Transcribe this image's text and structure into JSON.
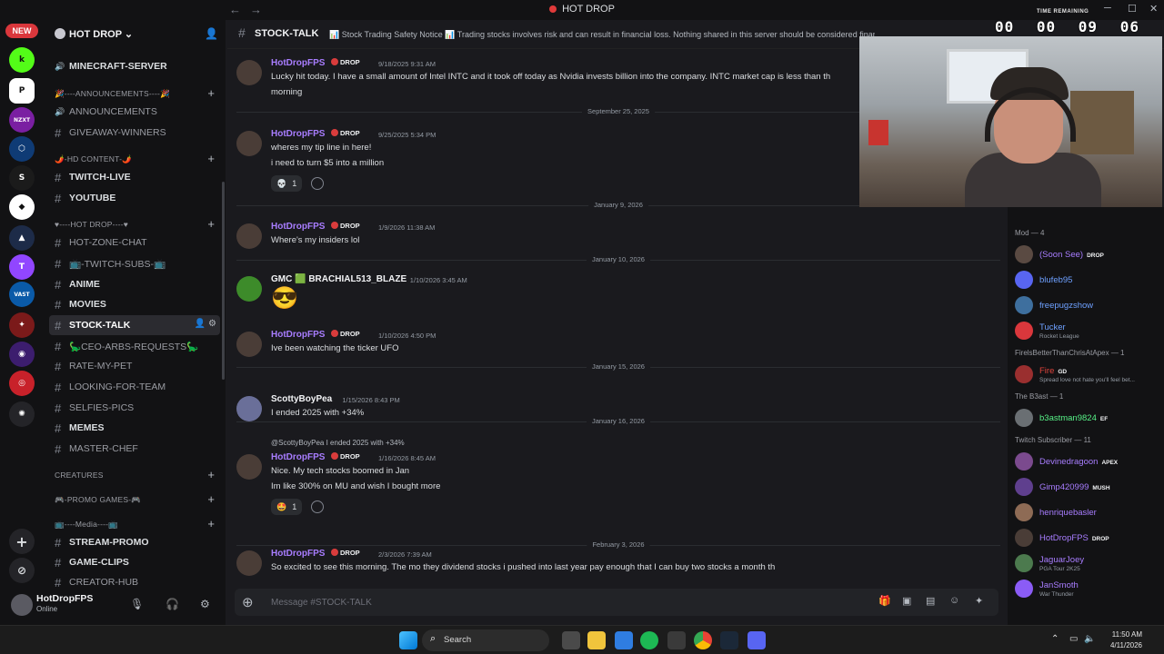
{
  "window": {
    "title": "HOT DROP"
  },
  "server_rail": {
    "new_badge": "NEW",
    "servers": [
      {
        "name": "kick-server",
        "color": "#53fc18",
        "glyph": "k"
      },
      {
        "name": "p-server",
        "color": "#ffffff",
        "glyph": "P"
      },
      {
        "name": "nzxt-server",
        "color": "#7a1fa2",
        "glyph": "NZXT"
      },
      {
        "name": "hex-server",
        "color": "#0f3b75",
        "glyph": "⬡"
      },
      {
        "name": "sanctuary-server",
        "color": "#1b1b1b",
        "glyph": "S"
      },
      {
        "name": "cube-server",
        "color": "#ffffff",
        "glyph": "◆"
      },
      {
        "name": "mountain-server",
        "color": "#1d2b48",
        "glyph": "▲"
      },
      {
        "name": "twitch-server",
        "color": "#9146ff",
        "glyph": "T"
      },
      {
        "name": "vast-server",
        "color": "#0a5aa8",
        "glyph": "VAST"
      },
      {
        "name": "feather-server",
        "color": "#7b1a1a",
        "glyph": "✦"
      },
      {
        "name": "purple-server",
        "color": "#3c1d6e",
        "glyph": "◉"
      },
      {
        "name": "red-ring-server",
        "color": "#c8212a",
        "glyph": "◎"
      },
      {
        "name": "dark-server",
        "color": "#242428",
        "glyph": "✺"
      }
    ]
  },
  "guild": {
    "name": "HOT DROP",
    "categories_and_channels": [
      {
        "kind": "channel",
        "label": "MINECRAFT-SERVER",
        "muted": false,
        "icon": "speaker"
      },
      {
        "kind": "category",
        "label": "🎉----ANNOUNCEMENTS----🎉"
      },
      {
        "kind": "channel",
        "label": "ANNOUNCEMENTS",
        "muted": true,
        "icon": "speaker"
      },
      {
        "kind": "channel",
        "label": "GIVEAWAY-WINNERS",
        "muted": true
      },
      {
        "kind": "category",
        "label": "🌶️-HD CONTENT-🌶️"
      },
      {
        "kind": "channel",
        "label": "TWITCH-LIVE",
        "muted": false
      },
      {
        "kind": "channel",
        "label": "YOUTUBE",
        "muted": false
      },
      {
        "kind": "category",
        "label": "♥----HOT DROP----♥"
      },
      {
        "kind": "channel",
        "label": "HOT-ZONE-CHAT",
        "muted": true
      },
      {
        "kind": "channel",
        "label": "📺-TWITCH-SUBS-📺",
        "muted": true
      },
      {
        "kind": "channel",
        "label": "ANIME",
        "muted": false
      },
      {
        "kind": "channel",
        "label": "MOVIES",
        "muted": false
      },
      {
        "kind": "channel",
        "label": "STOCK-TALK",
        "muted": false,
        "selected": true
      },
      {
        "kind": "channel",
        "label": "🦕CEO-ARBS-REQUESTS🦕",
        "muted": true
      },
      {
        "kind": "channel",
        "label": "RATE-MY-PET",
        "muted": true
      },
      {
        "kind": "channel",
        "label": "LOOKING-FOR-TEAM",
        "muted": true
      },
      {
        "kind": "channel",
        "label": "SELFIES-PICS",
        "muted": true
      },
      {
        "kind": "channel",
        "label": "MEMES",
        "muted": false
      },
      {
        "kind": "channel",
        "label": "MASTER-CHEF",
        "muted": true
      },
      {
        "kind": "category",
        "label": "CREATURES"
      },
      {
        "kind": "category",
        "label": "🎮-PROMO GAMES-🎮"
      },
      {
        "kind": "category",
        "label": "📺----Media----📺"
      },
      {
        "kind": "channel",
        "label": "STREAM-PROMO",
        "muted": false
      },
      {
        "kind": "channel",
        "label": "GAME-CLIPS",
        "muted": false
      },
      {
        "kind": "channel",
        "label": "CREATOR-HUB",
        "muted": true
      }
    ]
  },
  "user_panel": {
    "name": "HotDropFPS",
    "status": "Online"
  },
  "channel_header": {
    "name": "STOCK-TALK",
    "topic": "📊 Stock Trading Safety Notice 📊 Trading stocks involves risk and can result in financial loss. Nothing shared in this server should be considered financial..."
  },
  "messages": [
    {
      "type": "msg",
      "author": "HotDropFPS",
      "tag": "DROP",
      "time": "9/18/2025 9:31 AM",
      "avatar": "#4a3d37",
      "lines": [
        "Lucky hit today. I have a small amount of Intel INTC and it took off today as Nvidia invests billion into the company. INTC market cap is less than th",
        "morning"
      ]
    },
    {
      "type": "divider",
      "label": "September 25, 2025"
    },
    {
      "type": "msg",
      "author": "HotDropFPS",
      "tag": "DROP",
      "time": "9/25/2025 5:34 PM",
      "avatar": "#4a3d37",
      "lines": [
        "wheres my tip line in here!",
        "i need to turn $5 into a million"
      ],
      "reaction": {
        "emoji": "💀",
        "count": "1"
      }
    },
    {
      "type": "divider",
      "label": "January 9, 2026"
    },
    {
      "type": "msg",
      "author": "HotDropFPS",
      "tag": "DROP",
      "time": "1/9/2026 11:38 AM",
      "avatar": "#4a3d37",
      "lines": [
        "Where's my insiders lol"
      ]
    },
    {
      "type": "divider",
      "label": "January 10, 2026"
    },
    {
      "type": "msg",
      "author": "GMC 🟩 BRACHIAL513_BLAZE",
      "tag": "",
      "time": "1/10/2026 3:45 AM",
      "avatar": "#3d8b2a",
      "lines": [
        "😎"
      ],
      "plain": true
    },
    {
      "type": "msg",
      "author": "HotDropFPS",
      "tag": "DROP",
      "time": "1/10/2026 4:50 PM",
      "avatar": "#4a3d37",
      "lines": [
        "Ive been watching the ticker UFO"
      ]
    },
    {
      "type": "divider",
      "label": "January 15, 2026"
    },
    {
      "type": "msg",
      "author": "ScottyBoyPea",
      "tag": "",
      "time": "1/15/2026 8:43 PM",
      "avatar": "#6a6f99",
      "lines": [
        "I ended 2025 with +34%"
      ],
      "plain": true
    },
    {
      "type": "divider",
      "label": "January 16, 2026"
    },
    {
      "type": "msg",
      "author": "HotDropFPS",
      "tag": "DROP",
      "time": "1/16/2026 8:45 AM",
      "avatar": "#4a3d37",
      "reply": "@ScottyBoyPea I ended 2025 with +34%",
      "lines": [
        "Nice. My tech stocks boomed in Jan",
        "Im like 300% on MU and wish I bought more"
      ],
      "reaction": {
        "emoji": "🤩",
        "count": "1"
      }
    },
    {
      "type": "divider",
      "label": "February 3, 2026"
    },
    {
      "type": "msg",
      "author": "HotDropFPS",
      "tag": "DROP",
      "time": "2/3/2026 7:39 AM",
      "avatar": "#4a3d37",
      "lines": [
        "So excited to see this morning. The mo they dividend stocks i pushed into last year pay enough that I can buy two stocks a month th"
      ]
    }
  ],
  "composer": {
    "placeholder": "Message #STOCK-TALK"
  },
  "stream_overlay": {
    "timer_label": "TIME REMAINING",
    "timer": "00 00 09 06"
  },
  "member_list": {
    "groups": [
      {
        "label": "Mod — 4",
        "members": [
          {
            "name": "(Soon See)",
            "tag": "DROP",
            "color": "#a87dff",
            "sub": ""
          },
          {
            "name": "blufeb95",
            "tag": "",
            "color": "#6ea0ff",
            "sub": ""
          },
          {
            "name": "freepugzshow",
            "tag": "",
            "color": "#6ea0ff",
            "sub": ""
          },
          {
            "name": "Tucker",
            "tag": "",
            "color": "#6ea0ff",
            "sub": "Rocket League"
          }
        ]
      },
      {
        "label": "FirelsBetterThanChrisAtApex — 1",
        "members": [
          {
            "name": "Fire",
            "tag": "GD",
            "color": "#e0443c",
            "sub": "Spread love not hate you'll feel bet..."
          }
        ]
      },
      {
        "label": "The B3ast — 1",
        "members": [
          {
            "name": "b3astman9824",
            "tag": "EF",
            "color": "#57f287",
            "sub": ""
          }
        ]
      },
      {
        "label": "Twitch Subscriber — 11",
        "members": [
          {
            "name": "Devinedragoon",
            "tag": "APEX",
            "color": "#a87dff",
            "sub": ""
          },
          {
            "name": "Gimp420999",
            "tag": "MUSH",
            "color": "#a87dff",
            "sub": ""
          },
          {
            "name": "henriquebasler",
            "tag": "",
            "color": "#a87dff",
            "sub": ""
          },
          {
            "name": "HotDropFPS",
            "tag": "DROP",
            "color": "#a87dff",
            "sub": ""
          },
          {
            "name": "JaguarJoey",
            "tag": "",
            "color": "#a87dff",
            "sub": "PGA Tour 2K25"
          },
          {
            "name": "JanSmoth",
            "tag": "",
            "color": "#a87dff",
            "sub": "War Thunder"
          }
        ]
      }
    ]
  },
  "taskbar": {
    "search_label": "Search",
    "time": "11:50 AM",
    "date": "4/11/2026"
  }
}
